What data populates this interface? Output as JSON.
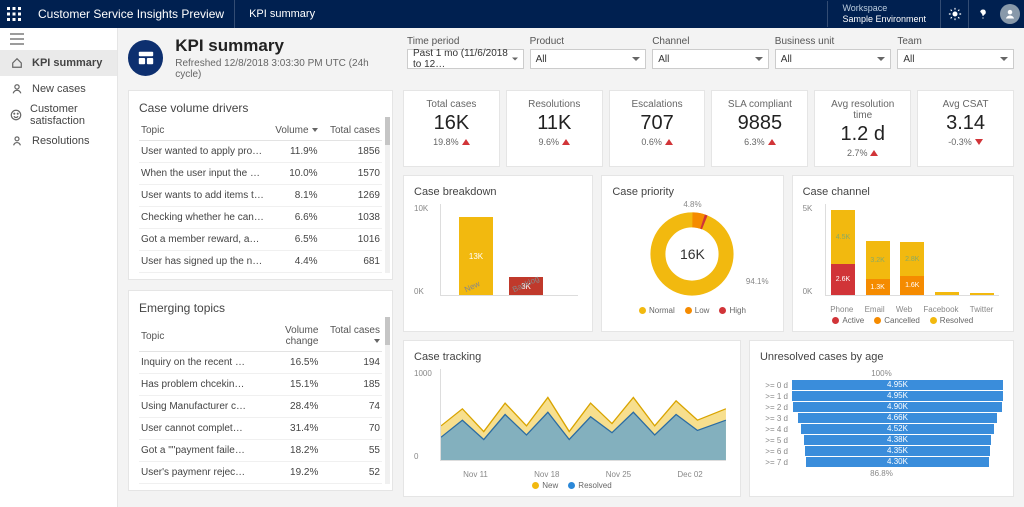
{
  "topbar": {
    "brand": "Customer Service Insights Preview",
    "crumb": "KPI summary",
    "workspace_label": "Workspace",
    "workspace_value": "Sample Environment"
  },
  "sidebar": {
    "items": [
      {
        "label": "KPI summary",
        "icon": "home"
      },
      {
        "label": "New cases",
        "icon": "user"
      },
      {
        "label": "Customer satisfaction",
        "icon": "smile"
      },
      {
        "label": "Resolutions",
        "icon": "person"
      }
    ]
  },
  "page": {
    "title": "KPI summary",
    "subtitle": "Refreshed 12/8/2018 3:03:30 PM UTC (24h cycle)"
  },
  "filters": [
    {
      "label": "Time period",
      "value": "Past 1 mo (11/6/2018 to 12…"
    },
    {
      "label": "Product",
      "value": "All"
    },
    {
      "label": "Channel",
      "value": "All"
    },
    {
      "label": "Business unit",
      "value": "All"
    },
    {
      "label": "Team",
      "value": "All"
    }
  ],
  "drivers": {
    "title": "Case volume drivers",
    "headers": {
      "topic": "Topic",
      "volume": "Volume",
      "total": "Total cases"
    },
    "rows": [
      {
        "t": "User wanted to apply pro…",
        "v": "11.9%",
        "c": "1856"
      },
      {
        "t": "When the user input the c…",
        "v": "10.0%",
        "c": "1570"
      },
      {
        "t": "User wants to add items to…",
        "v": "8.1%",
        "c": "1269"
      },
      {
        "t": "Checking whether he can r…",
        "v": "6.6%",
        "c": "1038"
      },
      {
        "t": "Got a member reward, and…",
        "v": "6.5%",
        "c": "1016"
      },
      {
        "t": "User has signed up the ne…",
        "v": "4.4%",
        "c": "681"
      }
    ]
  },
  "emerging": {
    "title": "Emerging topics",
    "headers": {
      "topic": "Topic",
      "volume": "Volume change",
      "total": "Total cases"
    },
    "rows": [
      {
        "t": "Inquiry on the recent deals…",
        "v": "16.5%",
        "c": "194"
      },
      {
        "t": "Has problem chceking exp…",
        "v": "15.1%",
        "c": "185"
      },
      {
        "t": "Using Manufacturer coup…",
        "v": "28.4%",
        "c": "74"
      },
      {
        "t": "User cannot complete a pa…",
        "v": "31.4%",
        "c": "70"
      },
      {
        "t": "Got a \"\"payment failed\"\" …",
        "v": "18.2%",
        "c": "55"
      },
      {
        "t": "User's paymenr rejected d…",
        "v": "19.2%",
        "c": "52"
      }
    ]
  },
  "kpis": [
    {
      "label": "Total cases",
      "value": "16K",
      "delta": "19.8%",
      "dir": "up"
    },
    {
      "label": "Resolutions",
      "value": "11K",
      "delta": "9.6%",
      "dir": "up"
    },
    {
      "label": "Escalations",
      "value": "707",
      "delta": "0.6%",
      "dir": "up"
    },
    {
      "label": "SLA compliant",
      "value": "9885",
      "delta": "6.3%",
      "dir": "up"
    },
    {
      "label": "Avg resolution time",
      "value": "1.2 d",
      "delta": "2.7%",
      "dir": "up"
    },
    {
      "label": "Avg CSAT",
      "value": "3.14",
      "delta": "-0.3%",
      "dir": "down"
    }
  ],
  "breakdown": {
    "title": "Case breakdown"
  },
  "priority": {
    "title": "Case priority",
    "center": "16K",
    "top": "4.8%",
    "right": "94.1%",
    "legend": [
      "Normal",
      "Low",
      "High"
    ]
  },
  "channel": {
    "title": "Case channel",
    "legend": [
      "Active",
      "Cancelled",
      "Resolved"
    ]
  },
  "tracking": {
    "title": "Case tracking",
    "legend": [
      "New",
      "Resolved"
    ]
  },
  "unresolved": {
    "title": "Unresolved cases by age",
    "top": "100%",
    "bottom": "86.8%"
  },
  "chart_data": [
    {
      "type": "bar",
      "title": "Case breakdown",
      "categories": [
        "New",
        "Backlog"
      ],
      "values": [
        13000,
        3000
      ],
      "labels": [
        "13K",
        "3K"
      ],
      "ylim": [
        0,
        15000
      ],
      "yticks": [
        "10K",
        "0K"
      ]
    },
    {
      "type": "pie",
      "title": "Case priority",
      "total": "16K",
      "series": [
        {
          "name": "Normal",
          "value": 94.1
        },
        {
          "name": "Low",
          "value": 4.8
        },
        {
          "name": "High",
          "value": 1.1
        }
      ]
    },
    {
      "type": "bar",
      "title": "Case channel",
      "categories": [
        "Phone",
        "Email",
        "Web",
        "Facebook",
        "Twitter"
      ],
      "ylim": [
        0,
        6000
      ],
      "yticks": [
        "5K",
        "0K"
      ],
      "series": [
        {
          "name": "Active",
          "color": "#d13438",
          "values": [
            2600,
            0,
            0,
            0,
            0
          ],
          "labels": [
            "2.6K",
            "",
            "",
            "",
            ""
          ]
        },
        {
          "name": "Resolved",
          "color": "#f2b90f",
          "values": [
            4500,
            3200,
            2800,
            0,
            0
          ],
          "labels": [
            "4.5K",
            "3.2K",
            "2.8K",
            "",
            ""
          ]
        },
        {
          "name": "Cancelled",
          "color": "#f58b00",
          "values": [
            0,
            1300,
            1600,
            0,
            0
          ],
          "labels": [
            "",
            "1.3K",
            "1.6K",
            "",
            ""
          ]
        }
      ]
    },
    {
      "type": "area",
      "title": "Case tracking",
      "x": [
        "Nov 11",
        "Nov 18",
        "Nov 25",
        "Dec 02"
      ],
      "ylim": [
        0,
        1000
      ],
      "yticks": [
        "1000",
        "0"
      ],
      "series": [
        {
          "name": "New",
          "color": "#f2b90f"
        },
        {
          "name": "Resolved",
          "color": "#2b88d8"
        }
      ]
    },
    {
      "type": "bar",
      "title": "Unresolved cases by age",
      "orientation": "horizontal",
      "categories": [
        ">= 0 d",
        ">= 1 d",
        ">= 2 d",
        ">= 3 d",
        ">= 4 d",
        ">= 5 d",
        ">= 6 d",
        ">= 7 d"
      ],
      "values": [
        4950,
        4950,
        4900,
        4660,
        4520,
        4380,
        4350,
        4300
      ],
      "labels": [
        "4.95K",
        "4.95K",
        "4.90K",
        "4.66K",
        "4.52K",
        "4.38K",
        "4.35K",
        "4.30K"
      ],
      "top_pct": "100%",
      "bottom_pct": "86.8%"
    }
  ]
}
